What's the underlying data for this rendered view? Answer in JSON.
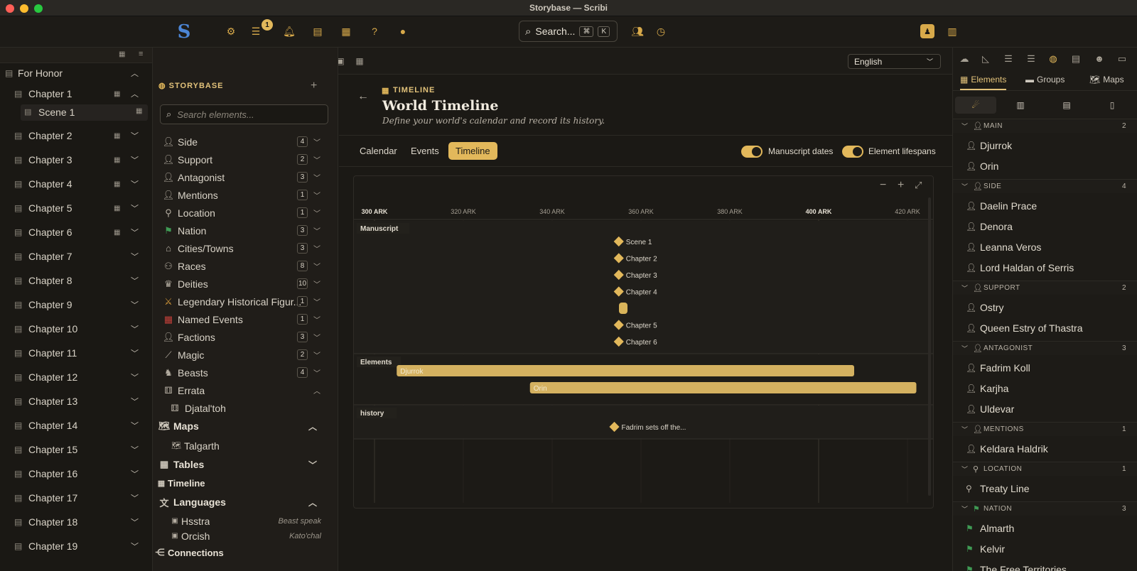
{
  "window": {
    "title": "Storybase — Scribi"
  },
  "topbar": {
    "search_label": "Search...",
    "kbd_cmd": "⌘",
    "kbd_key": "K",
    "notification_count": "1"
  },
  "left": {
    "project": "For Honor",
    "chapters": [
      {
        "label": "Chapter 1",
        "cal": true,
        "open": true
      },
      {
        "label": "Chapter 2",
        "cal": true
      },
      {
        "label": "Chapter 3",
        "cal": true
      },
      {
        "label": "Chapter 4",
        "cal": true
      },
      {
        "label": "Chapter 5",
        "cal": true
      },
      {
        "label": "Chapter 6",
        "cal": true
      },
      {
        "label": "Chapter 7"
      },
      {
        "label": "Chapter 8"
      },
      {
        "label": "Chapter 9"
      },
      {
        "label": "Chapter 10"
      },
      {
        "label": "Chapter 11"
      },
      {
        "label": "Chapter 12"
      },
      {
        "label": "Chapter 13"
      },
      {
        "label": "Chapter 14"
      },
      {
        "label": "Chapter 15"
      },
      {
        "label": "Chapter 16"
      },
      {
        "label": "Chapter 17"
      },
      {
        "label": "Chapter 18"
      },
      {
        "label": "Chapter 19"
      }
    ],
    "scene": "Scene 1"
  },
  "storybase": {
    "heading": "STORYBASE",
    "search_placeholder": "Search elements...",
    "items": [
      {
        "label": "Side",
        "count": "4",
        "icon": "person-icon"
      },
      {
        "label": "Support",
        "count": "2",
        "icon": "person-icon"
      },
      {
        "label": "Antagonist",
        "count": "3",
        "icon": "person-icon"
      },
      {
        "label": "Mentions",
        "count": "1",
        "icon": "person-icon"
      },
      {
        "label": "Location",
        "count": "1",
        "icon": "map-pin-icon"
      },
      {
        "label": "Nation",
        "count": "3",
        "icon": "flag-icon"
      },
      {
        "label": "Cities/Towns",
        "count": "3",
        "icon": "house-icon"
      },
      {
        "label": "Races",
        "count": "8",
        "icon": "group-icon"
      },
      {
        "label": "Deities",
        "count": "10",
        "icon": "crown-icon"
      },
      {
        "label": "Legendary Historical Figur...",
        "count": "1",
        "icon": "sword-icon"
      },
      {
        "label": "Named Events",
        "count": "1",
        "icon": "calendar-icon"
      },
      {
        "label": "Factions",
        "count": "3",
        "icon": "person-icon"
      },
      {
        "label": "Magic",
        "count": "2",
        "icon": "wand-icon"
      },
      {
        "label": "Beasts",
        "count": "4",
        "icon": "beast-icon"
      },
      {
        "label": "Errata",
        "count": "",
        "icon": "grid-icon"
      }
    ],
    "errata_child": "Djatal'toh",
    "maps": "Maps",
    "map_child": "Talgarth",
    "tables": "Tables",
    "timeline": "Timeline",
    "languages": "Languages",
    "lang_items": [
      {
        "label": "Hsstra",
        "note": "Beast speak"
      },
      {
        "label": "Orcish",
        "note": "Kato'chal"
      }
    ],
    "connections": "Connections"
  },
  "main": {
    "language": "English",
    "crumb": "TIMELINE",
    "title": "World Timeline",
    "subtitle": "Define your world's calendar and record its history.",
    "tabs": [
      "Calendar",
      "Events",
      "Timeline"
    ],
    "toggle1": "Manuscript dates",
    "toggle2": "Element lifespans"
  },
  "chart_data": {
    "type": "timeline",
    "x_ticks": [
      "300 ARK",
      "320 ARK",
      "340 ARK",
      "360 ARK",
      "380 ARK",
      "400 ARK",
      "420 ARK"
    ],
    "x_range": [
      296,
      424
    ],
    "lanes": [
      {
        "name": "Manuscript",
        "markers": [
          {
            "label": "Scene 1",
            "x": 355
          },
          {
            "label": "Chapter 2",
            "x": 355
          },
          {
            "label": "Chapter 3",
            "x": 355
          },
          {
            "label": "Chapter 4",
            "x": 355
          },
          {
            "label": "",
            "x": 356,
            "shape": "pill"
          },
          {
            "label": "Chapter 5",
            "x": 355
          },
          {
            "label": "Chapter 6",
            "x": 355
          }
        ]
      },
      {
        "name": "Elements",
        "bars": [
          {
            "label": "Djurrok",
            "start": 305,
            "end": 408
          },
          {
            "label": "Orin",
            "start": 335,
            "end": 422
          }
        ]
      },
      {
        "name": "history",
        "markers": [
          {
            "label": "Fadrim sets off the...",
            "x": 354
          }
        ]
      }
    ]
  },
  "right": {
    "tabs": [
      "Elements",
      "Groups",
      "Maps"
    ],
    "groups": [
      {
        "name": "MAIN",
        "count": "2",
        "icon": "person-icon",
        "items": [
          "Djurrok",
          "Orin"
        ]
      },
      {
        "name": "SIDE",
        "count": "4",
        "icon": "person-icon",
        "items": [
          "Daelin Prace",
          "Denora",
          "Leanna Veros",
          "Lord Haldan of Serris"
        ]
      },
      {
        "name": "SUPPORT",
        "count": "2",
        "icon": "person-icon",
        "items": [
          "Ostry",
          "Queen Estry of Thastra"
        ]
      },
      {
        "name": "ANTAGONIST",
        "count": "3",
        "icon": "person-icon",
        "items": [
          "Fadrim Koll",
          "Karjha",
          "Uldevar"
        ]
      },
      {
        "name": "MENTIONS",
        "count": "1",
        "icon": "person-icon",
        "items": [
          "Keldara Haldrik"
        ]
      },
      {
        "name": "LOCATION",
        "count": "1",
        "icon": "map-pin-icon",
        "items": [
          "Treaty Line"
        ]
      },
      {
        "name": "NATION",
        "count": "3",
        "icon": "flag-icon",
        "items": [
          "Almarth",
          "Kelvir",
          "The Free Territories"
        ]
      }
    ]
  },
  "colors": {
    "accent": "#e2b85b",
    "bg": "#1b1915"
  }
}
